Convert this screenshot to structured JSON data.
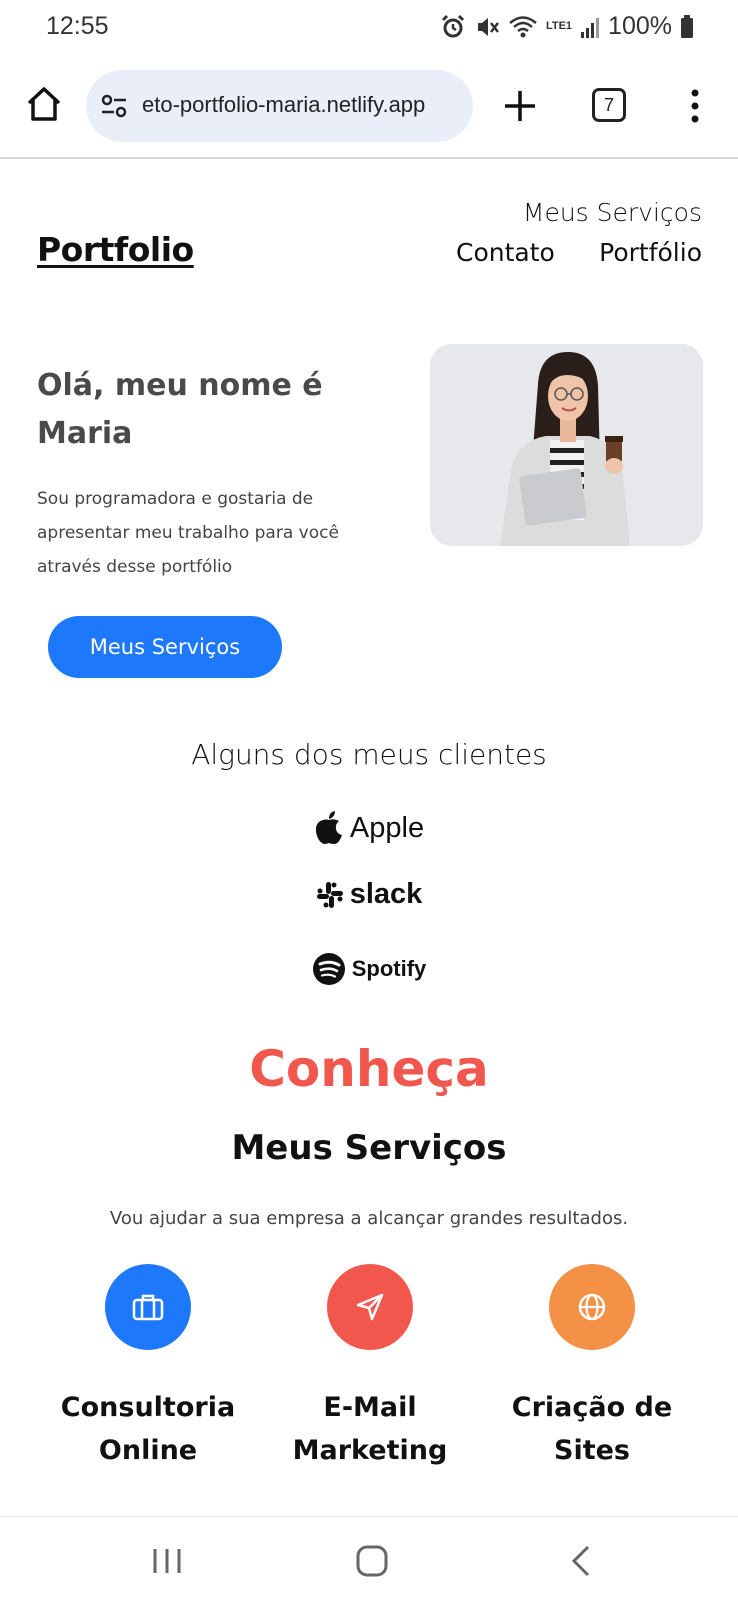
{
  "status_bar": {
    "time": "12:55",
    "battery": "100%",
    "network": "LTE1"
  },
  "browser": {
    "url": "eto-portfolio-maria.netlify.app",
    "tab_count": "7"
  },
  "site": {
    "logo": "Portfolio",
    "nav": {
      "services": "Meus Serviços",
      "contact": "Contato",
      "portfolio": "Portfólio"
    }
  },
  "hero": {
    "title": "Olá, meu nome é Maria",
    "text": "Sou programadora e gostaria de apresentar meu trabalho para você através desse portfólio",
    "button": "Meus Serviços"
  },
  "clients": {
    "title": "Alguns dos meus clientes",
    "logos": [
      "Apple",
      "slack",
      "Spotify"
    ]
  },
  "services": {
    "eyebrow": "Conheça",
    "title": "Meus Serviços",
    "text": "Vou ajudar a sua empresa a alcançar grandes resultados.",
    "items": [
      {
        "label": "Consultoria Online",
        "icon": "briefcase-icon",
        "color": "#1e78fb"
      },
      {
        "label": "E-Mail Marketing",
        "icon": "send-icon",
        "color": "#f2574e"
      },
      {
        "label": "Criação de Sites",
        "icon": "globe-icon",
        "color": "#f59047"
      }
    ]
  }
}
